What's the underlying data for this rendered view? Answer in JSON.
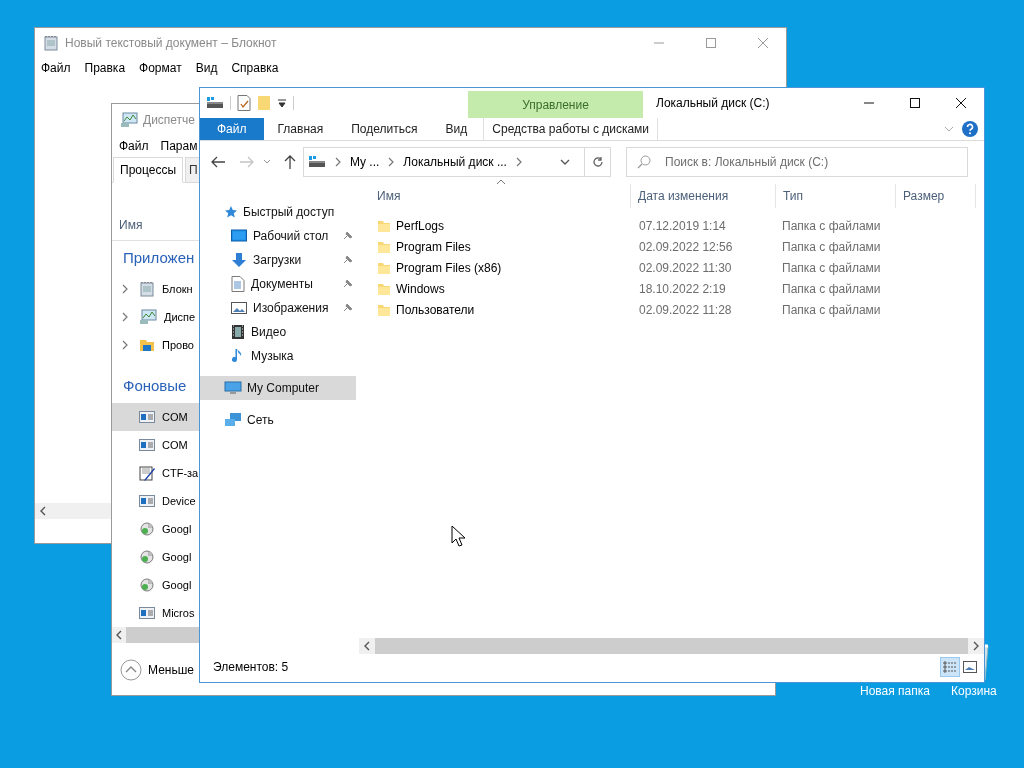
{
  "notepad": {
    "title": "Новый текстовый документ – Блокнот",
    "menu": [
      "Файл",
      "Правка",
      "Формат",
      "Вид",
      "Справка"
    ]
  },
  "task_manager": {
    "title": "Диспетче",
    "menu": [
      "Файл",
      "Парам"
    ],
    "tabs": [
      {
        "label": "Процессы",
        "selected": true
      },
      {
        "label": "П",
        "selected": false
      }
    ],
    "column": "Имя",
    "groups": [
      {
        "title": "Приложен",
        "rows": [
          {
            "label": "Блокн",
            "expandable": true,
            "selected": false
          },
          {
            "label": "Диспе",
            "expandable": true,
            "selected": false
          },
          {
            "label": "Прово",
            "expandable": true,
            "selected": false
          }
        ]
      },
      {
        "title": "Фоновые",
        "rows": [
          {
            "label": "COM",
            "expandable": false,
            "selected": true
          },
          {
            "label": "COM",
            "expandable": false,
            "selected": false
          },
          {
            "label": "CTF-за",
            "expandable": false,
            "selected": false
          },
          {
            "label": "Device",
            "expandable": false,
            "selected": false
          },
          {
            "label": "Googl",
            "expandable": false,
            "selected": false
          },
          {
            "label": "Googl",
            "expandable": false,
            "selected": false
          },
          {
            "label": "Googl",
            "expandable": false,
            "selected": false
          },
          {
            "label": "Micros",
            "expandable": false,
            "selected": false
          }
        ]
      }
    ],
    "footer": "Меньше"
  },
  "explorer": {
    "title": "Локальный диск (C:)",
    "context_group": "Управление",
    "ribbon_tabs": [
      {
        "label": "Файл",
        "kind": "file"
      },
      {
        "label": "Главная",
        "kind": "tab"
      },
      {
        "label": "Поделиться",
        "kind": "tab"
      },
      {
        "label": "Вид",
        "kind": "tab"
      },
      {
        "label": "Средства работы с дисками",
        "kind": "context"
      }
    ],
    "address": [
      "My ...",
      "Локальный диск ..."
    ],
    "search": {
      "placeholder": "Поиск в: Локальный диск (C:)"
    },
    "nav": [
      {
        "label": "Быстрый доступ",
        "selected": false,
        "children": [
          {
            "label": "Рабочий стол",
            "pinned": true
          },
          {
            "label": "Загрузки",
            "pinned": true
          },
          {
            "label": "Документы",
            "pinned": true
          },
          {
            "label": "Изображения",
            "pinned": true
          },
          {
            "label": "Видео",
            "pinned": false
          },
          {
            "label": "Музыка",
            "pinned": false
          }
        ]
      },
      {
        "label": "My Computer",
        "selected": true
      },
      {
        "label": "Сеть",
        "selected": false
      }
    ],
    "columns": [
      {
        "label": "Имя",
        "sorted": true
      },
      {
        "label": "Дата изменения",
        "sorted": false
      },
      {
        "label": "Тип",
        "sorted": false
      },
      {
        "label": "Размер",
        "sorted": false
      }
    ],
    "rows": [
      {
        "name": "PerfLogs",
        "date": "07.12.2019 1:14",
        "type": "Папка с файлами"
      },
      {
        "name": "Program Files",
        "date": "02.09.2022 12:56",
        "type": "Папка с файлами"
      },
      {
        "name": "Program Files (x86)",
        "date": "02.09.2022 11:30",
        "type": "Папка с файлами"
      },
      {
        "name": "Windows",
        "date": "18.10.2022 2:19",
        "type": "Папка с файлами"
      },
      {
        "name": "Пользователи",
        "date": "02.09.2022 11:28",
        "type": "Папка с файлами"
      }
    ],
    "status": "Элементов: 5",
    "view_buttons": [
      {
        "kind": "details",
        "selected": true
      },
      {
        "kind": "thumbnails",
        "selected": false
      }
    ]
  },
  "desktop": {
    "icons": [
      {
        "label": "Новая папка",
        "kind": "folder"
      },
      {
        "label": "Корзина",
        "kind": "bin"
      }
    ]
  }
}
